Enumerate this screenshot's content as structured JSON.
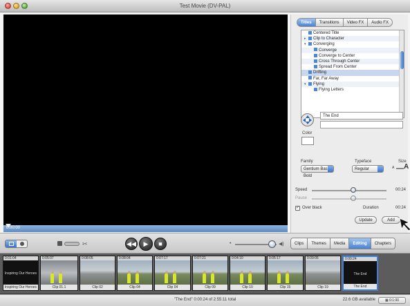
{
  "window": {
    "title": "Test Movie (DV-PAL)"
  },
  "viewer": {
    "timecode": "0:00:00"
  },
  "panel": {
    "tabs": [
      {
        "label": "Titles",
        "active": true
      },
      {
        "label": "Transitions",
        "active": false
      },
      {
        "label": "Video FX",
        "active": false
      },
      {
        "label": "Audio FX",
        "active": false
      }
    ],
    "title_styles": [
      {
        "label": "Centered Title",
        "level": 0,
        "twisty": ""
      },
      {
        "label": "Clip to Character",
        "level": 0,
        "twisty": "▸"
      },
      {
        "label": "Converging",
        "level": 0,
        "twisty": "▾"
      },
      {
        "label": "Converge",
        "level": 1,
        "twisty": ""
      },
      {
        "label": "Converge to Center",
        "level": 1,
        "twisty": ""
      },
      {
        "label": "Cross Through Center",
        "level": 1,
        "twisty": ""
      },
      {
        "label": "Spread From Center",
        "level": 1,
        "twisty": ""
      },
      {
        "label": "Drifting",
        "level": 0,
        "twisty": ""
      },
      {
        "label": "Far, Far Away",
        "level": 0,
        "twisty": ""
      },
      {
        "label": "Flying",
        "level": 0,
        "twisty": "▾"
      },
      {
        "label": "Flying Letters",
        "level": 1,
        "twisty": ""
      }
    ],
    "title_text": "The End",
    "color_label": "Color",
    "family_label": "Family",
    "family_value": "Gentium Basic Bold",
    "typeface_label": "Typeface",
    "typeface_value": "Regular",
    "size_label": "Size",
    "size_small_glyph": "A",
    "size_large_glyph": "A",
    "speed_label": "Speed",
    "speed_value": "00:24",
    "pause_label": "Pause",
    "over_black_label": "Over black",
    "over_black_checked": true,
    "duration_label": "Duration",
    "duration_value": "00:24",
    "update_label": "Update",
    "add_label": "Add"
  },
  "toolbar": {
    "rewind_icon": "◀◀",
    "play_icon": "▶",
    "fullscreen_icon": "■",
    "modes": [
      {
        "label": "Clips",
        "active": false
      },
      {
        "label": "Themes",
        "active": false
      },
      {
        "label": "Media",
        "active": false
      },
      {
        "label": "Editing",
        "active": true
      },
      {
        "label": "Chapters",
        "active": false
      }
    ]
  },
  "timeline": {
    "clips": [
      {
        "tc": "0:01:04",
        "name": "Inspiring Our Heroes",
        "scene": "dark",
        "thumb_text": "Inspiring Our Heroes"
      },
      {
        "tc": "0:05:07",
        "name": "Clip 01.1",
        "scene": "grey"
      },
      {
        "tc": "0:08:05",
        "name": "Clip 02",
        "scene": "road"
      },
      {
        "tc": "0:08:04",
        "name": "Clip 04",
        "scene": "sky"
      },
      {
        "tc": "0:07:17",
        "name": "Clip 04",
        "scene": "sky"
      },
      {
        "tc": "0:07:21",
        "name": "Clip 09",
        "scene": "sky"
      },
      {
        "tc": "0:04:10",
        "name": "Clip 10",
        "scene": "sky"
      },
      {
        "tc": "0:05:17",
        "name": "Clip 15",
        "scene": "sky"
      },
      {
        "tc": "0:09:05",
        "name": "Clip 19",
        "scene": "road"
      },
      {
        "tc": "0:00:24",
        "name": "The End",
        "scene": "dark",
        "thumb_text": "The End",
        "selected": true
      }
    ]
  },
  "status": {
    "center": "\"The End\"  0:00:24 of 2:55:11 total",
    "right": "22.6 GB available",
    "button": "▦ 0:1:00"
  }
}
